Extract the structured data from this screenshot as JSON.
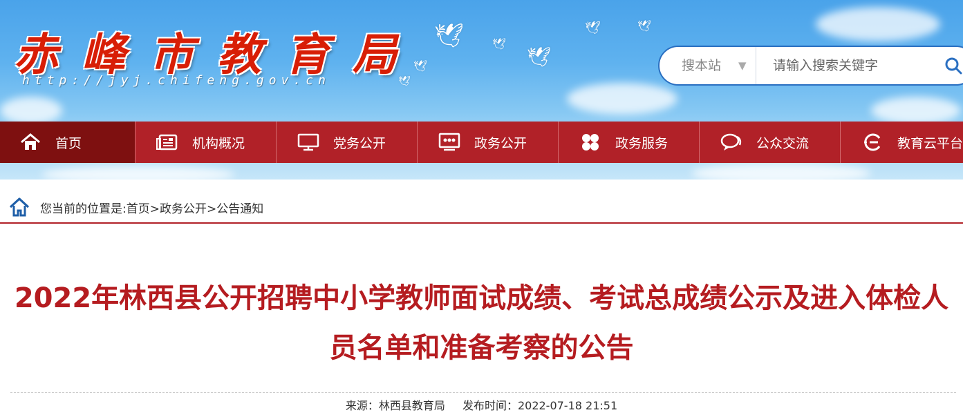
{
  "header": {
    "site_name": "赤峰市教育局",
    "site_url": "http://jyj.chifeng.gov.cn"
  },
  "search": {
    "scope_label": "搜本站",
    "scope_caret": "▼",
    "placeholder": "请输入搜索关键字",
    "button_icon": "search-icon"
  },
  "nav": {
    "items": [
      {
        "label": "首页",
        "icon": "home-icon"
      },
      {
        "label": "机构概况",
        "icon": "newspaper-icon"
      },
      {
        "label": "党务公开",
        "icon": "monitor-icon"
      },
      {
        "label": "政务公开",
        "icon": "display-board-icon"
      },
      {
        "label": "政务服务",
        "icon": "grid-icon"
      },
      {
        "label": "公众交流",
        "icon": "chat-icon"
      },
      {
        "label": "教育云平台",
        "icon": "cloud-e-icon"
      }
    ]
  },
  "breadcrumb": {
    "text": "您当前的位置是:首页>政务公开>公告通知"
  },
  "article": {
    "title": "2022年林西县公开招聘中小学教师面试成绩、考试总成绩公示及进入体检人员名单和准备考察的公告",
    "source": "来源：林西县教育局",
    "published": "发布时间：2022-07-18 21:51"
  },
  "colors": {
    "nav_bg": "#b12128",
    "nav_active": "#7e1010",
    "title_red": "#b51c20",
    "search_border": "#2a6fc1"
  }
}
